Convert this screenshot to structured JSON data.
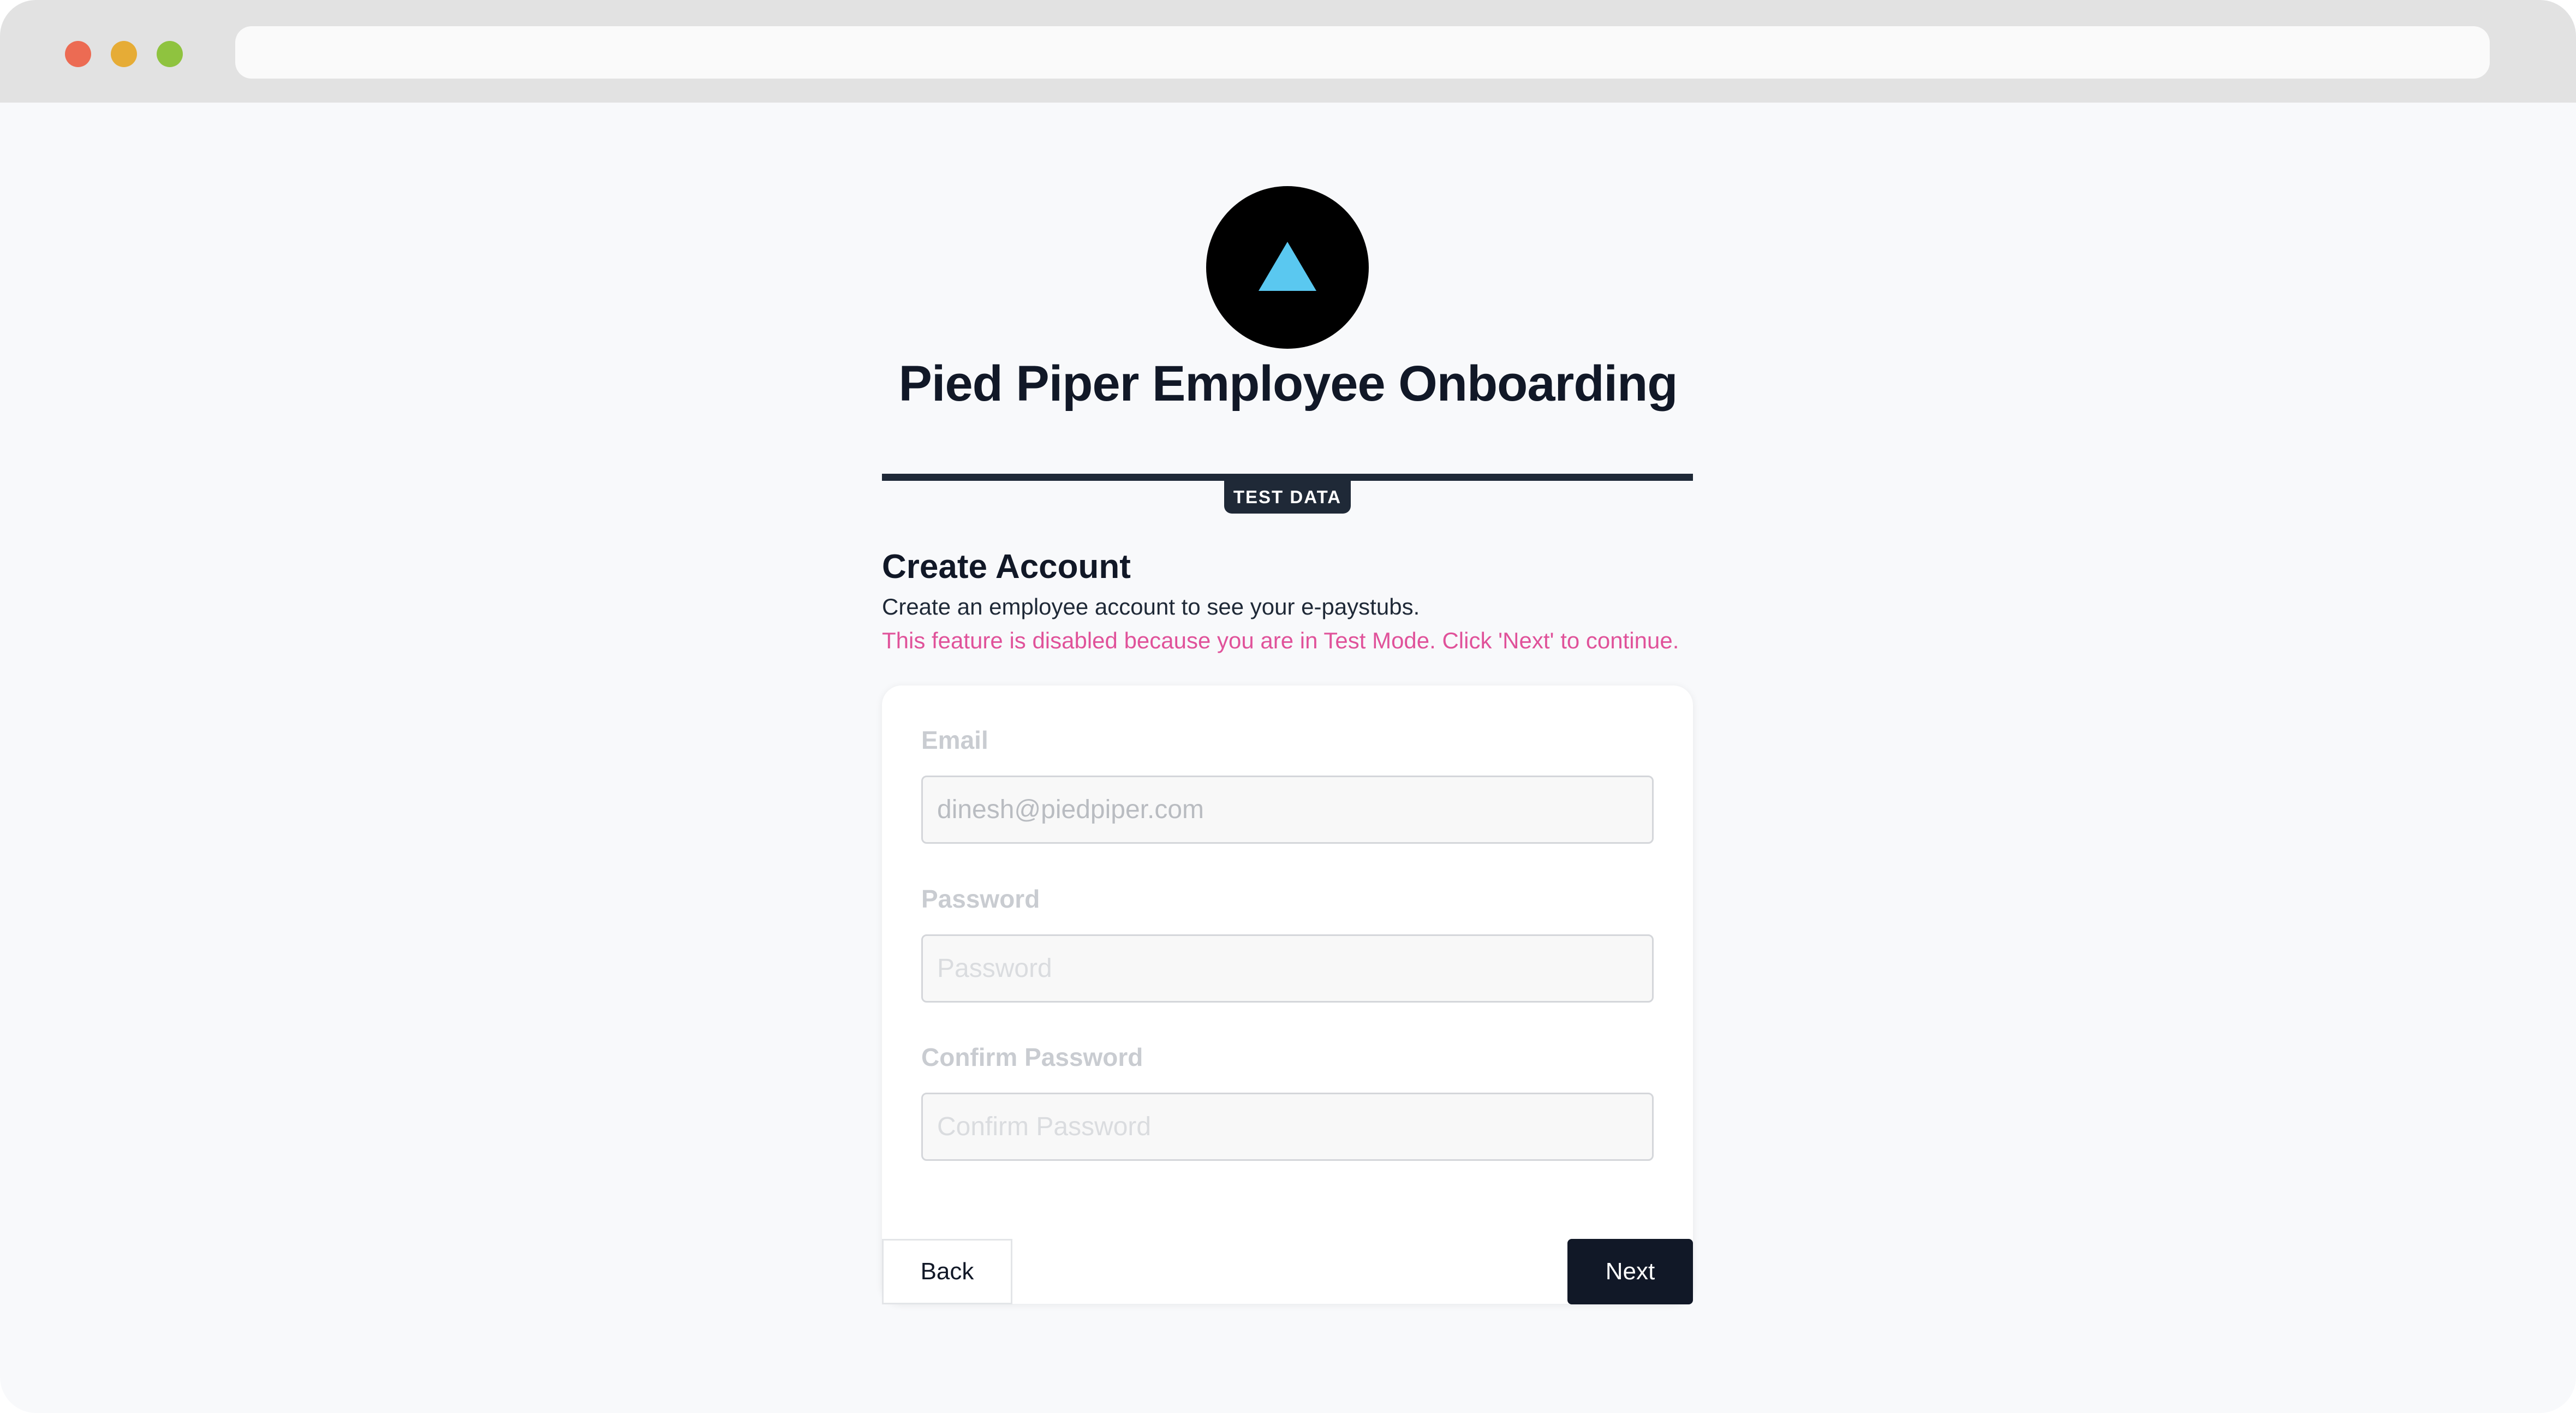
{
  "app": {
    "title": "Pied Piper Employee Onboarding",
    "badge": "TEST DATA",
    "logo_icon": "triangle-icon",
    "colors": {
      "accent": "#5ac8f0",
      "dark": "#111827",
      "warning": "#e0529a"
    }
  },
  "section": {
    "title": "Create Account",
    "description": "Create an employee account to see your e-paystubs.",
    "test_mode_note": "This feature is disabled because you are in Test Mode. Click 'Next' to continue."
  },
  "form": {
    "email_label": "Email",
    "email_value": "dinesh@piedpiper.com",
    "password_label": "Password",
    "password_placeholder": "Password",
    "confirm_label": "Confirm Password",
    "confirm_placeholder": "Confirm Password"
  },
  "buttons": {
    "back": "Back",
    "next": "Next"
  }
}
